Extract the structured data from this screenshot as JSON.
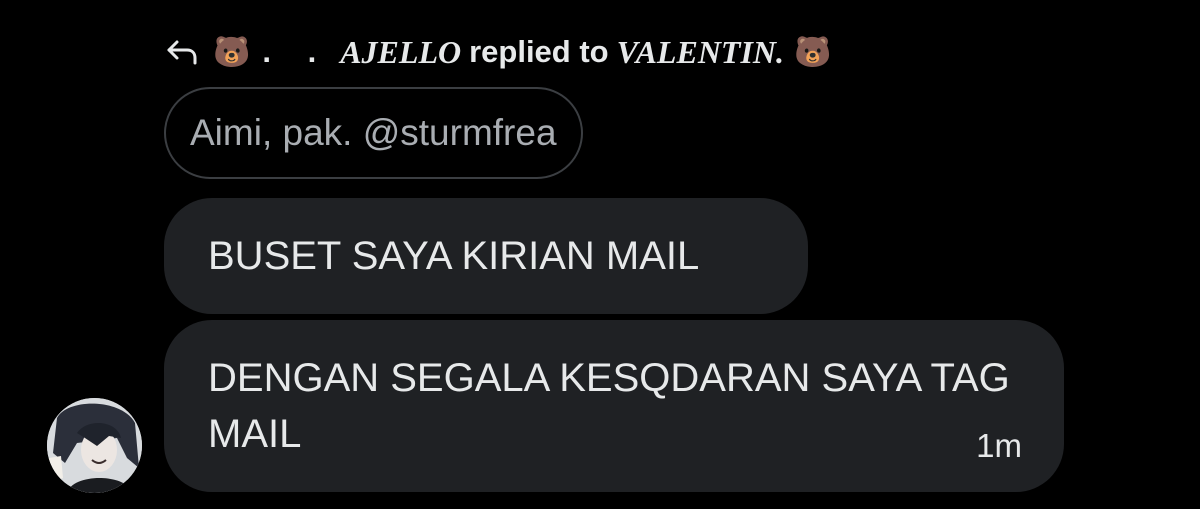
{
  "reply_header": {
    "leading_emoji": "🐻",
    "dots": ". .",
    "sender_name": "AJELLO",
    "action_text": "replied to",
    "recipient_name": "VALENTIN.",
    "trailing_emoji": "🐻"
  },
  "quoted_message": {
    "text": "Aimi, pak. @sturmfrea"
  },
  "messages": [
    {
      "text": "BUSET SAYA KIRIAN MAIL"
    },
    {
      "text": "DENGAN SEGALA KESQDARAN SAYA TAG MAIL",
      "timestamp": "1m"
    }
  ],
  "colors": {
    "background": "#000000",
    "bubble": "#1f2124",
    "text": "#e7e9ea",
    "muted_text": "#a9adb2",
    "quote_border": "#3b3e42"
  },
  "icons": {
    "reply": "reply-arrow-icon",
    "avatar": "user-avatar"
  }
}
